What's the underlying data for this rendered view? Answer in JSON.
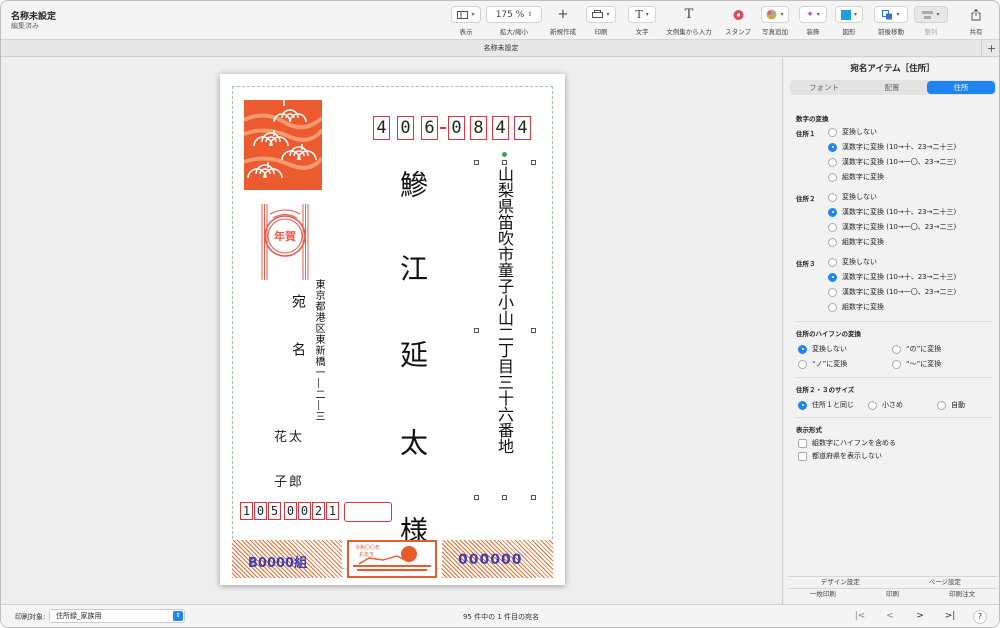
{
  "window": {
    "doc_title": "名称未設定",
    "doc_subtitle": "編集済み",
    "tab_title": "名称未設定",
    "tab_add": "+"
  },
  "toolbar": {
    "display_label": "表示",
    "zoom_value": "175 %",
    "zoom_label": "拡大/縮小",
    "new_label": "新規作成",
    "print_label": "印刷",
    "text_label": "文字",
    "text_glyph": "T",
    "text_from_list_label": "文例集から入力",
    "text_from_list_glyph": "T",
    "stamp_label": "スタンプ",
    "photo_label": "写真追加",
    "decorate_label": "装飾",
    "shape_label": "図形",
    "arrange_label": "前後移動",
    "align_label": "整列",
    "share_label": "共有"
  },
  "card": {
    "postal_digits": [
      "4",
      "0",
      "6",
      "0",
      "8",
      "4",
      "4"
    ],
    "address": "山梨県笛吹市童子小山二丁目三十六番地",
    "name_line1": "鰺　江",
    "name_line2": "延　太　様",
    "nenga_label": "年賀",
    "atena_line1": "宛",
    "atena_line2": "名",
    "sender_address": "東京都港区東新橋一―二―三",
    "sender_name1": "花太",
    "sender_name2": "子郎",
    "sender_zip_digits": [
      "1",
      "0",
      "5",
      "0",
      "0",
      "2",
      "1"
    ],
    "lottery_group": "B0000組",
    "lottery_number": "000000",
    "stamp_text_line1": "令和〇〇年",
    "stamp_text_line2": "お年玉"
  },
  "panel": {
    "title": "宛名アイテム［住所］",
    "tabs": [
      "フォント",
      "配置",
      "住所"
    ],
    "active_tab": "住所",
    "number_conversion_title": "数字の変換",
    "address_groups": [
      {
        "label": "住所１",
        "options": [
          "変換しない",
          "漢数字に変換 (10→十、23→二十三)",
          "漢数字に変換 (10→一〇、23→二三)",
          "組数字に変換"
        ],
        "selected": 1
      },
      {
        "label": "住所２",
        "options": [
          "変換しない",
          "漢数字に変換 (10→十、23→二十三)",
          "漢数字に変換 (10→一〇、23→二三)",
          "組数字に変換"
        ],
        "selected": 1
      },
      {
        "label": "住所３",
        "options": [
          "変換しない",
          "漢数字に変換 (10→十、23→二十三)",
          "漢数字に変換 (10→一〇、23→二三)",
          "組数字に変換"
        ],
        "selected": 1
      }
    ],
    "hyphen_title": "住所のハイフンの変換",
    "hyphen_options": [
      "変換しない",
      "“の”に変換",
      "“ノ”に変換",
      "“〜”に変換"
    ],
    "size_title": "住所２・３のサイズ",
    "size_options": [
      "住所１と同じ",
      "小さめ",
      "自動"
    ],
    "display_title": "表示形式",
    "display_checks": [
      "組数字にハイフンを含める",
      "都道府県を表示しない"
    ],
    "bottom_buttons": [
      "デザイン設定",
      "ページ設定",
      "一枚印刷",
      "印刷",
      "印刷注文"
    ]
  },
  "status": {
    "print_target_label": "印刷対象:",
    "print_target_value": "住所録_家族用",
    "record_info": "95 件中の 1 件目の宛名",
    "nav_first": "|<",
    "nav_prev": "<",
    "nav_next": ">",
    "nav_last": ">|",
    "help": "?"
  },
  "colors": {
    "accent": "#1e84f0",
    "postal_red": "#d9343b",
    "band_orange": "#f06a2c",
    "band_text": "#3b3fb3"
  }
}
